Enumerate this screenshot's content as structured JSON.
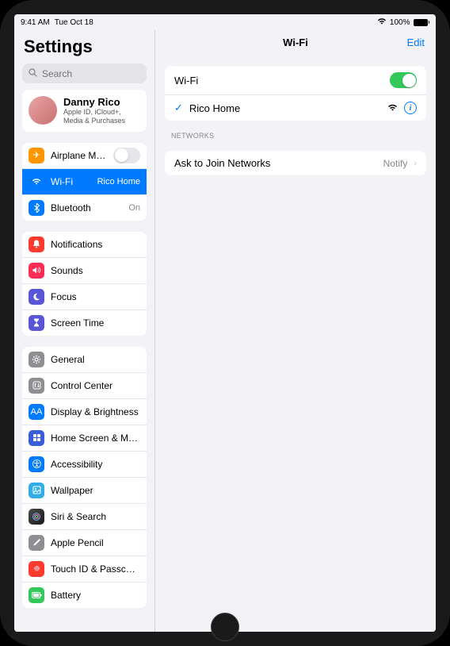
{
  "status": {
    "time": "9:41 AM",
    "date": "Tue Oct 18",
    "battery": "100%"
  },
  "sidebar": {
    "title": "Settings",
    "searchPlaceholder": "Search",
    "profile": {
      "name": "Danny Rico",
      "sub": "Apple ID, iCloud+, Media & Purchases"
    },
    "g1": {
      "airplane": "Airplane Mode",
      "wifi": "Wi-Fi",
      "wifiVal": "Rico Home",
      "bt": "Bluetooth",
      "btVal": "On"
    },
    "g2": {
      "notif": "Notifications",
      "sounds": "Sounds",
      "focus": "Focus",
      "screentime": "Screen Time"
    },
    "g3": {
      "general": "General",
      "cc": "Control Center",
      "display": "Display & Brightness",
      "home": "Home Screen & Multitas…",
      "access": "Accessibility",
      "wallpaper": "Wallpaper",
      "siri": "Siri & Search",
      "pencil": "Apple Pencil",
      "touchid": "Touch ID & Passcode",
      "battery": "Battery"
    }
  },
  "detail": {
    "title": "Wi-Fi",
    "edit": "Edit",
    "wifiLabel": "Wi-Fi",
    "currentNetwork": "Rico Home",
    "networksHeader": "NETWORKS",
    "askToJoin": "Ask to Join Networks",
    "askToJoinVal": "Notify"
  },
  "colors": {
    "orange": "#ff9500",
    "blue": "#007aff",
    "red": "#ff3b30",
    "indigo": "#5856d6",
    "grey": "#8e8e93",
    "green": "#34c759",
    "cyan": "#32ade6",
    "darkgrey": "#636366",
    "pink": "#ff2d55",
    "black": "#1c1c1e"
  }
}
